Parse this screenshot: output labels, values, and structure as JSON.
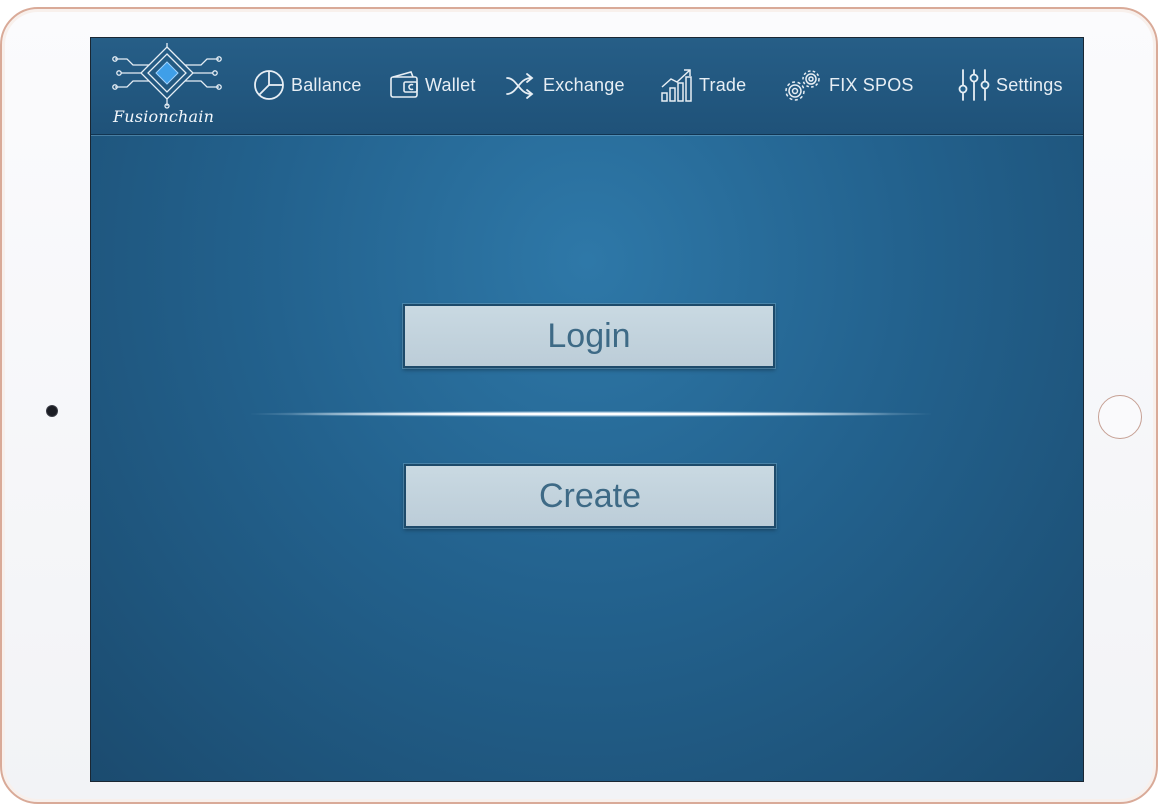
{
  "app": {
    "name": "Fusionchain"
  },
  "nav": {
    "items": [
      {
        "label": "Ballance",
        "icon": "pie-chart-icon"
      },
      {
        "label": "Wallet",
        "icon": "wallet-icon"
      },
      {
        "label": "Exchange",
        "icon": "shuffle-icon"
      },
      {
        "label": "Trade",
        "icon": "trend-chart-icon"
      },
      {
        "label": "FIX SPOS",
        "icon": "gears-icon"
      },
      {
        "label": "Settings",
        "icon": "sliders-icon"
      }
    ]
  },
  "main": {
    "login_label": "Login",
    "create_label": "Create"
  },
  "colors": {
    "screen_bg": "#23628e",
    "topbar_bg": "#265e87",
    "button_bg": "#c3d3dd",
    "button_text": "#3e6a86",
    "device_frame": "#d9aa98"
  }
}
